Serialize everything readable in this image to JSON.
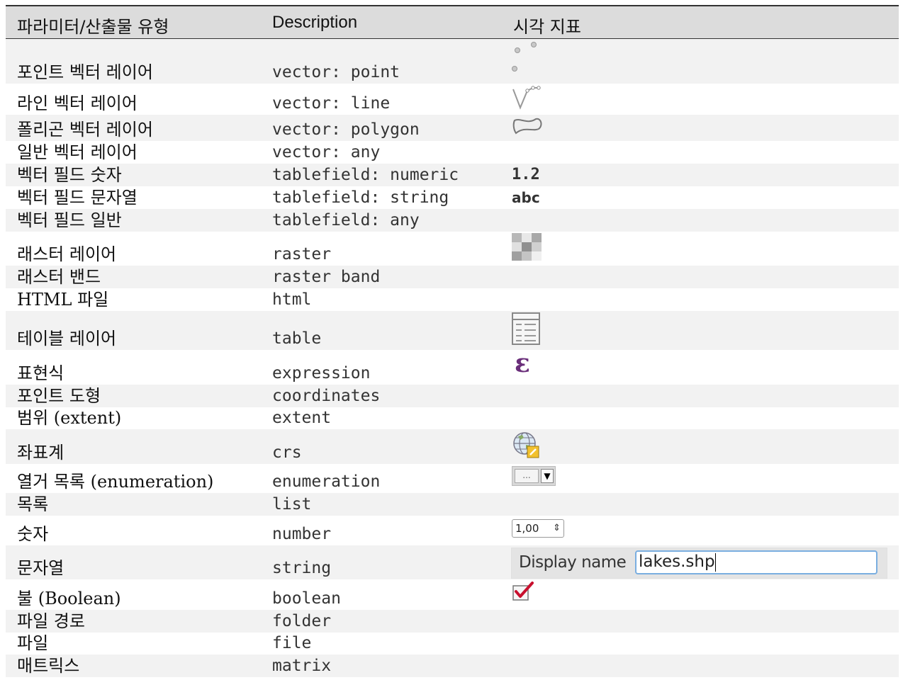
{
  "headers": [
    "파라미터/산출물 유형",
    "Description",
    "시각 지표"
  ],
  "rows": [
    {
      "param": "포인트 벡터 레이어",
      "desc": "vector: point",
      "icon": "point-layer-icon"
    },
    {
      "param": "라인 벡터 레이어",
      "desc": "vector: line",
      "icon": "line-layer-icon"
    },
    {
      "param": "폴리곤 벡터 레이어",
      "desc": "vector: polygon",
      "icon": "polygon-layer-icon"
    },
    {
      "param": "일반 벡터 레이어",
      "desc": "vector: any",
      "icon": ""
    },
    {
      "param": "벡터 필드 숫자",
      "desc": "tablefield: numeric",
      "icon": "numeric-field-icon",
      "value": "1.2"
    },
    {
      "param": "벡터 필드 문자열",
      "desc": "tablefield: string",
      "icon": "string-field-icon",
      "value": "abc"
    },
    {
      "param": "벡터 필드 일반",
      "desc": "tablefield: any",
      "icon": ""
    },
    {
      "param": "래스터 레이어",
      "desc": "raster",
      "icon": "raster-layer-icon"
    },
    {
      "param": "래스터 밴드",
      "desc": "raster band",
      "icon": ""
    },
    {
      "param": "HTML 파일",
      "desc": "html",
      "icon": ""
    },
    {
      "param": "테이블 레이어",
      "desc": "table",
      "icon": "table-layer-icon"
    },
    {
      "param": "표현식",
      "desc": "expression",
      "icon": "expression-icon"
    },
    {
      "param": "포인트 도형",
      "desc": "coordinates",
      "icon": ""
    },
    {
      "param": "범위 (extent)",
      "desc": "extent",
      "icon": ""
    },
    {
      "param": "좌표계",
      "desc": "crs",
      "icon": "crs-globe-icon"
    },
    {
      "param": "열거 목록 (enumeration)",
      "desc": "enumeration",
      "icon": "enumeration-combo-icon",
      "value": "..."
    },
    {
      "param": "목록",
      "desc": "list",
      "icon": ""
    },
    {
      "param": "숫자",
      "desc": "number",
      "icon": "number-spinbox-icon",
      "value": "1,00"
    },
    {
      "param": "문자열",
      "desc": "string",
      "icon": "string-input-icon",
      "label": "Display name",
      "value": "lakes.shp"
    },
    {
      "param": "불 (Boolean)",
      "desc": "boolean",
      "icon": "checkbox-checked-icon"
    },
    {
      "param": "파일 경로",
      "desc": "folder",
      "icon": ""
    },
    {
      "param": "파일",
      "desc": "file",
      "icon": ""
    },
    {
      "param": "매트릭스",
      "desc": "matrix",
      "icon": ""
    }
  ]
}
